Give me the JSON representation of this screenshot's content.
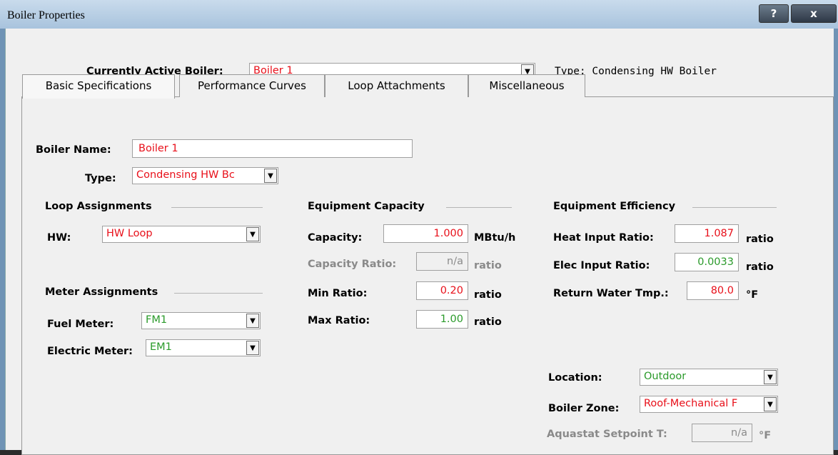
{
  "window": {
    "title": "Boiler Properties",
    "help_label": "?",
    "close_label": "x"
  },
  "header": {
    "active_label": "Currently Active Boiler:",
    "active_value": "Boiler 1",
    "type_text": "Type: Condensing HW Boiler"
  },
  "tabs": [
    {
      "label": "Basic Specifications"
    },
    {
      "label": "Performance Curves"
    },
    {
      "label": "Loop Attachments"
    },
    {
      "label": "Miscellaneous"
    }
  ],
  "basic": {
    "name_label": "Boiler Name:",
    "name_value": "Boiler 1",
    "type_label": "Type:",
    "type_value": "Condensing HW Bc"
  },
  "loop": {
    "heading": "Loop Assignments",
    "hw_label": "HW:",
    "hw_value": "HW Loop"
  },
  "meter": {
    "heading": "Meter Assignments",
    "fuel_label": "Fuel Meter:",
    "fuel_value": "FM1",
    "elec_label": "Electric Meter:",
    "elec_value": "EM1"
  },
  "capacity": {
    "heading": "Equipment Capacity",
    "capacity_label": "Capacity:",
    "capacity_value": "1.000",
    "capacity_unit": "MBtu/h",
    "ratio_label": "Capacity Ratio:",
    "ratio_value": "n/a",
    "ratio_unit": "ratio",
    "min_label": "Min Ratio:",
    "min_value": "0.20",
    "min_unit": "ratio",
    "max_label": "Max Ratio:",
    "max_value": "1.00",
    "max_unit": "ratio"
  },
  "efficiency": {
    "heading": "Equipment Efficiency",
    "hir_label": "Heat Input Ratio:",
    "hir_value": "1.087",
    "hir_unit": "ratio",
    "eir_label": "Elec Input Ratio:",
    "eir_value": "0.0033",
    "eir_unit": "ratio",
    "rwt_label": "Return Water Tmp.:",
    "rwt_value": "80.0",
    "rwt_unit": "°F"
  },
  "location": {
    "location_label": "Location:",
    "location_value": "Outdoor",
    "zone_label": "Boiler Zone:",
    "zone_value": "Roof-Mechanical F",
    "aqua_label": "Aquastat Setpoint T:",
    "aqua_value": "n/a",
    "aqua_unit": "°F"
  },
  "colors": {
    "required": "#e8101a",
    "default": "#2a9a2a",
    "disabled": "#8a8a8a"
  }
}
